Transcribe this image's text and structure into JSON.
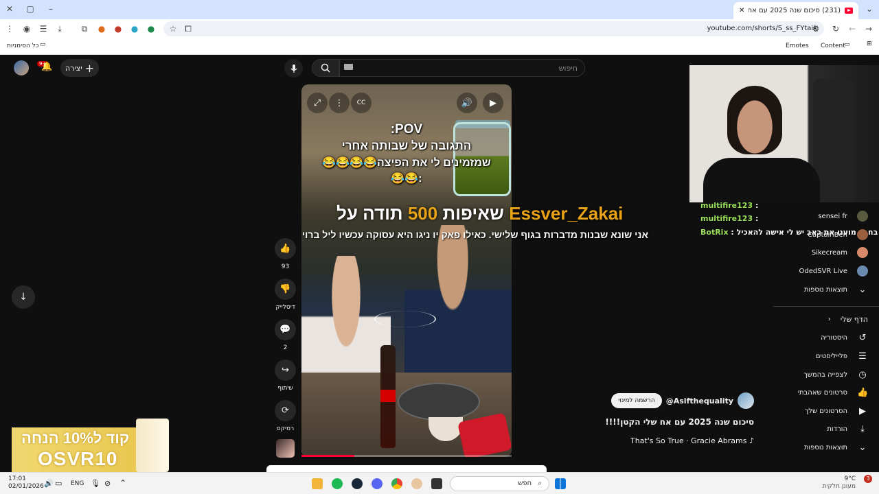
{
  "browser": {
    "tab_title": "(231) סיכום שנה 2025 עם אח ש",
    "url": "youtube.com/shorts/S_ss_FYtaik",
    "new_tab": "+",
    "bookmarks": {
      "all_bookmarks": "כל הסימניות",
      "content": "Content",
      "emotes": "Emotes"
    }
  },
  "header": {
    "search_placeholder": "חיפוש",
    "create_label": "יצירה",
    "notification_count": "9+"
  },
  "video": {
    "pov_line1": "POV:",
    "pov_line2": "התגובה של שבותה אחרי",
    "pov_line3": "שמזמינים לי את הפיצה😂😂😂😂",
    "pov_line4": ":😂😂",
    "overlay_name": "Essver_Zakai",
    "overlay_mid": " תודה על ",
    "overlay_amount": "500",
    "overlay_end": " שאיפות",
    "overlay_line2": "אני שונא שבנות מדברות בגוף שלישי. כאילו פאק יו ניגו היא עסוקה עכשיו ליל ברוי",
    "progress": 0.25
  },
  "actions": {
    "like_count": "93",
    "dislike_label": "דיסלייק",
    "comment_count": "2",
    "share_label": "שיתוף",
    "remix_label": "רמיקס"
  },
  "channel": {
    "handle": "@Asifthequality",
    "subscribe_label": "הרשמה למינוי",
    "video_title": "סיכום שנה 2025 עם אח שלי הקטן!!!!",
    "music": "That's So True · Gracie Abrams"
  },
  "sidebar": {
    "subscriptions": [
      {
        "label": "CaptainBen"
      },
      {
        "label": "Sikecream"
      },
      {
        "label": "OdedSVR Live"
      }
    ],
    "show_more_subs": "תוצאות נוספות",
    "you_section": "הדף שלי",
    "items": [
      {
        "label": "היסטוריה",
        "icon": "history-icon"
      },
      {
        "label": "פלייליסטים",
        "icon": "playlist-icon"
      },
      {
        "label": "לצפייה בהמשך",
        "icon": "clock-icon"
      },
      {
        "label": "סרטונים שאהבתי",
        "icon": "thumb-up-icon"
      },
      {
        "label": "הסרטונים שלך",
        "icon": "play-icon"
      },
      {
        "label": "הורדות",
        "icon": "download-icon"
      }
    ],
    "show_more": "תוצאות נוספות"
  },
  "stream_chat": [
    {
      "user": "multifire123",
      "text": ":",
      "color": "#9be15d"
    },
    {
      "user": "multifire123",
      "text": ":",
      "color": "#9be15d"
    },
    {
      "user": "BotRix",
      "text": ": בחבר מוענו את כאב יש לי אישה להאכיל",
      "color": "#9be15d"
    }
  ],
  "stream_sidebar_name": "sensei fr",
  "promo": {
    "line1": "קוד ל10% הנחה",
    "line2": "OSVR10"
  },
  "taskbar": {
    "weather_temp": "9°C",
    "weather_desc": "מעונן חלקית",
    "search_label": "חפש",
    "lang": "ENG",
    "time": "17:01",
    "date": "02/01/2026",
    "notif_count": "3"
  }
}
